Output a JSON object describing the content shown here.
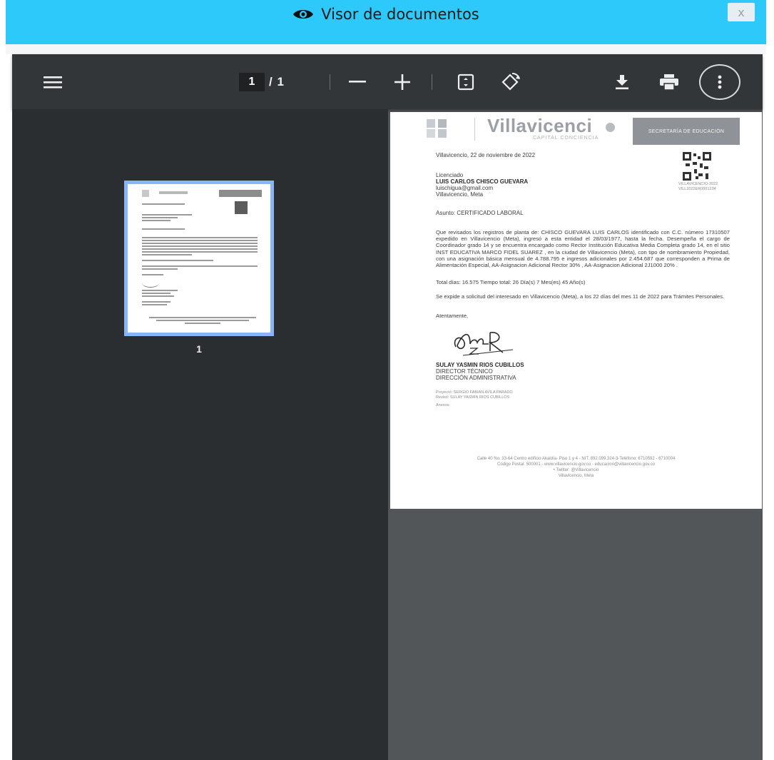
{
  "modal": {
    "title": "Visor de documentos",
    "close_label": "x"
  },
  "toolbar": {
    "current_page": "1",
    "total_pages": "/ 1",
    "icons": [
      "menu-icon",
      "zoom-out-icon",
      "zoom-in-icon",
      "fit-page-icon",
      "rotate-icon",
      "download-icon",
      "print-icon",
      "more-icon"
    ]
  },
  "sidebar": {
    "thumbnail_label": "1"
  },
  "document": {
    "logo_text": "Villavicenci",
    "logo_sub": "CAPITAL CONCIENCIA",
    "dept_banner": "SECRETARÍA DE EDUCACIÓN",
    "date_line": "Villavicencio, 22 de noviembre de 2022",
    "qr_caption_1": "VILLAVICENCIO-2022",
    "qr_caption_2": "VILL2022ER0001234",
    "recipient_title": "Licenciado",
    "recipient_name": "LUIS CARLOS CHISCO GUEVARA",
    "recipient_email": "luischigua@gmail.com",
    "recipient_city": "Villavicencio, Meta",
    "subject": "Asunto: CERTIFICADO LABORAL",
    "body_1": "Que revisados los registros de planta de: CHISCO GUEVARA LUIS CARLOS identificado con C.C. número 17310507 expedido en Villavicencio (Meta), ingresó a esta entidad el 28/03/1977, hasta la fecha. Desempeña el cargo de Coordinador grado 14 y se encuentra encargado como Rector Institución Educativa Media Completa grado 14, en el sitio INST EDUCATIVA MARCO FIDEL SUAREZ , en la ciudad de Villavicencio (Meta), con tipo de nombramiento Propiedad, con una asignación básica mensual de 4.788.795 e ingresos adicionales por 2.454.687 que corresponden a Prima de Alimentación Especial, AA-Asignacion Adicional Rector 30% , AA-Asignacion Adicional 2J1000 20% .",
    "body_2": "Total días: 16.575 Tiempo total: 26 Día(s) 7 Mes(es) 45 Año(s)",
    "body_3": "Se expide a solicitud del interesado en Villavicencio (Meta), a los 22 días del mes 11 de 2022 para Trámites Personales.",
    "closing": "Atentamente,",
    "signer_name": "SULAY YASMIN RIOS CUBILLOS",
    "signer_role_1": "DIRECTOR TÉCNICO",
    "signer_role_2": "DIRECCIÓN ADMINISTRATIVA",
    "proyecto": "Proyectó: SERGIO FABIAN AVILA PARADO",
    "reviso": "Revisó: SULAY YASMIN RIOS CUBILLOS",
    "anexos": "Anexos:",
    "footer_1": "Calle 40 No. 33-64 Centro edificio Akaldía- Piso 1 y 4 - NIT. 892.099.324-3-Teléfono: 6710592 - 6710004",
    "footer_2": "Código Postal: 500001 - www.villavicencio.gov.co - educacion@villavicencio.gov.co",
    "footer_3": "• Twitter: @Villavicencio",
    "footer_4": "Villavicencio, Meta"
  }
}
